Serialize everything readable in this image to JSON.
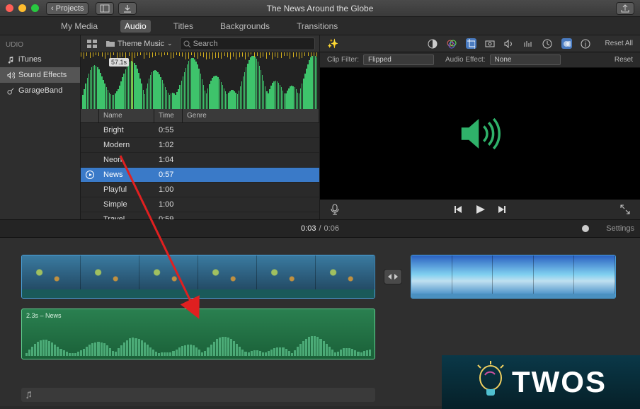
{
  "titlebar": {
    "projects_btn": "Projects",
    "title": "The News Around the Globe"
  },
  "tabs": {
    "my_media": "My Media",
    "audio": "Audio",
    "titles": "Titles",
    "backgrounds": "Backgrounds",
    "transitions": "Transitions",
    "active": "audio"
  },
  "sidebar": {
    "heading": "UDIO",
    "items": [
      {
        "label": "iTunes",
        "icon": "music-note-icon"
      },
      {
        "label": "Sound Effects",
        "icon": "sound-wave-icon"
      },
      {
        "label": "GarageBand",
        "icon": "guitar-icon"
      }
    ],
    "selected_index": 1
  },
  "browser": {
    "folder_label": "Theme Music",
    "search_placeholder": "Search",
    "preview_time_tag": "57.1s",
    "table": {
      "columns": {
        "name": "Name",
        "time": "Time",
        "genre": "Genre"
      },
      "rows": [
        {
          "name": "Bright",
          "time": "0:55",
          "genre": ""
        },
        {
          "name": "Modern",
          "time": "1:02",
          "genre": ""
        },
        {
          "name": "Neon",
          "time": "1:04",
          "genre": ""
        },
        {
          "name": "News",
          "time": "0:57",
          "genre": ""
        },
        {
          "name": "Playful",
          "time": "1:00",
          "genre": ""
        },
        {
          "name": "Simple",
          "time": "1:00",
          "genre": ""
        },
        {
          "name": "Travel",
          "time": "0:59",
          "genre": ""
        }
      ],
      "selected_index": 3
    }
  },
  "viewer": {
    "reset_all": "Reset All",
    "clip_filter_label": "Clip Filter:",
    "clip_filter_value": "Flipped",
    "audio_effect_label": "Audio Effect:",
    "audio_effect_value": "None",
    "reset": "Reset"
  },
  "scrubber": {
    "current": "0:03",
    "total": "0:06",
    "settings": "Settings"
  },
  "timeline": {
    "audio_clip_label": "2.3s – News"
  },
  "overlay": {
    "brand": "TWOS"
  }
}
